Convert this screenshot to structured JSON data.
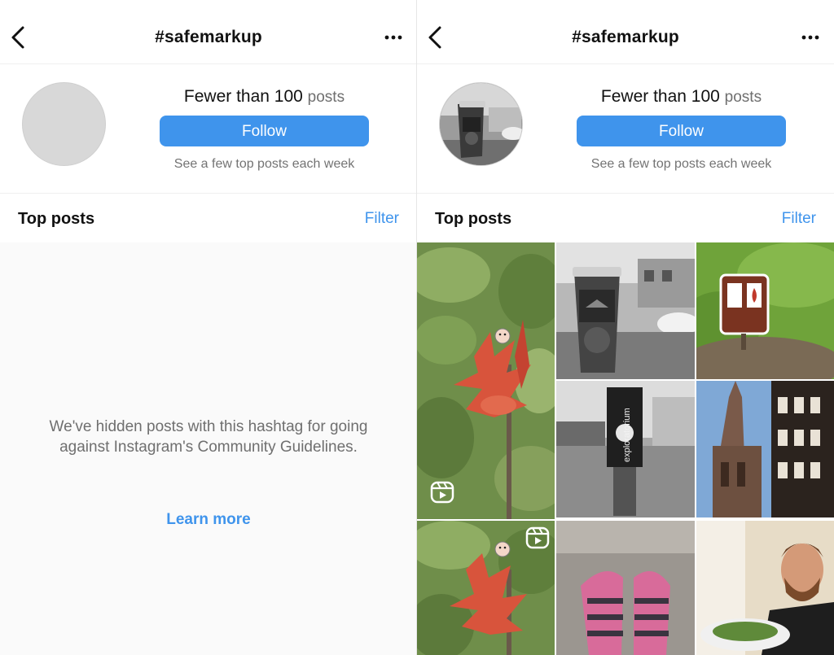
{
  "left_panel": {
    "header": {
      "title": "#safemarkup"
    },
    "info": {
      "count": "Fewer than 100",
      "count_unit": "posts",
      "follow_label": "Follow",
      "subtext": "See a few top posts each week"
    },
    "section": {
      "title": "Top posts",
      "filter_label": "Filter"
    },
    "hidden": {
      "message": "We've hidden posts with this hashtag for going against Instagram's Community Guidelines.",
      "learn_more": "Learn more"
    }
  },
  "right_panel": {
    "header": {
      "title": "#safemarkup"
    },
    "info": {
      "count": "Fewer than 100",
      "count_unit": "posts",
      "follow_label": "Follow",
      "subtext": "See a few top posts each week"
    },
    "section": {
      "title": "Top posts",
      "filter_label": "Filter"
    },
    "grid_posts": [
      {
        "subject": "red flower with sticker",
        "is_reel": true
      },
      {
        "subject": "black and white coffee cup on street"
      },
      {
        "subject": "brown park sign on grass"
      },
      {
        "subject": "exploratorium sign reflected in wet pavement"
      },
      {
        "subject": "gothic cathedral tower"
      },
      {
        "subject": "red flower with sticker",
        "is_reel": true
      },
      {
        "subject": "pink striped socks on floor"
      },
      {
        "subject": "smiling man eating salad"
      }
    ],
    "sign_text": "exploratorium"
  },
  "colors": {
    "accent_blue": "#3f94ec",
    "text_primary": "#111111",
    "text_secondary": "#737373",
    "avatar_placeholder": "#d8d8d8"
  },
  "icons": {
    "back": "chevron-left-icon",
    "more": "more-horizontal-icon",
    "reel": "reel-icon"
  }
}
